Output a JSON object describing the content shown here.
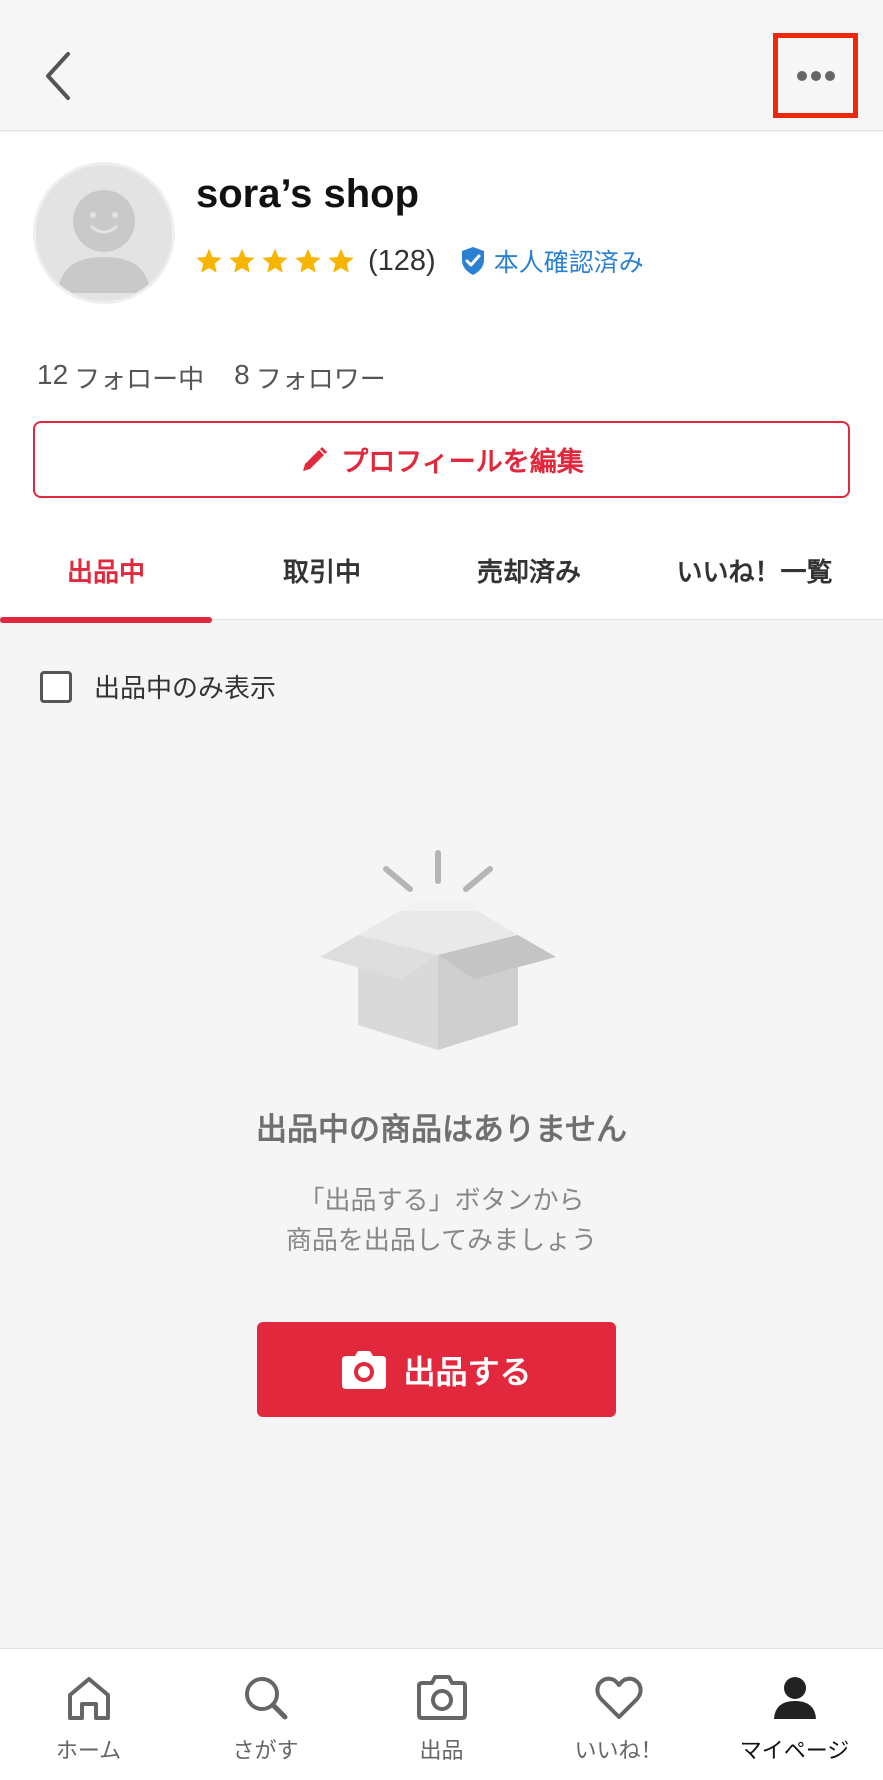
{
  "header": {
    "back_icon": "chevron-left-icon",
    "more_icon": "more-horizontal-icon"
  },
  "profile": {
    "shop_name": "sora’s shop",
    "rating_stars": 5,
    "review_count": "(128)",
    "verified_label": "本人確認済み",
    "following_count": "12",
    "following_label": "フォロー中",
    "followers_count": "8",
    "followers_label": "フォロワー",
    "edit_button_label": "プロフィールを編集"
  },
  "tabs": [
    {
      "label": "出品中",
      "active": true
    },
    {
      "label": "取引中",
      "active": false
    },
    {
      "label": "売却済み",
      "active": false
    },
    {
      "label": "いいね！一覧",
      "active": false
    }
  ],
  "filter": {
    "label": "出品中のみ表示",
    "checked": false
  },
  "empty_state": {
    "title": "出品中の商品はありません",
    "desc_line1": "「出品する」ボタンから",
    "desc_line2": "商品を出品してみましょう",
    "button_label": "出品する"
  },
  "bottom_nav": [
    {
      "label": "ホーム",
      "icon": "home-icon",
      "active": false
    },
    {
      "label": "さがす",
      "icon": "search-icon",
      "active": false
    },
    {
      "label": "出品",
      "icon": "camera-icon",
      "active": false
    },
    {
      "label": "いいね！",
      "icon": "heart-icon",
      "active": false
    },
    {
      "label": "マイページ",
      "icon": "user-icon",
      "active": true
    }
  ],
  "colors": {
    "accent": "#e1283c",
    "verified": "#2a80d2",
    "star": "#f7b500",
    "highlight_box": "#f0280a"
  }
}
